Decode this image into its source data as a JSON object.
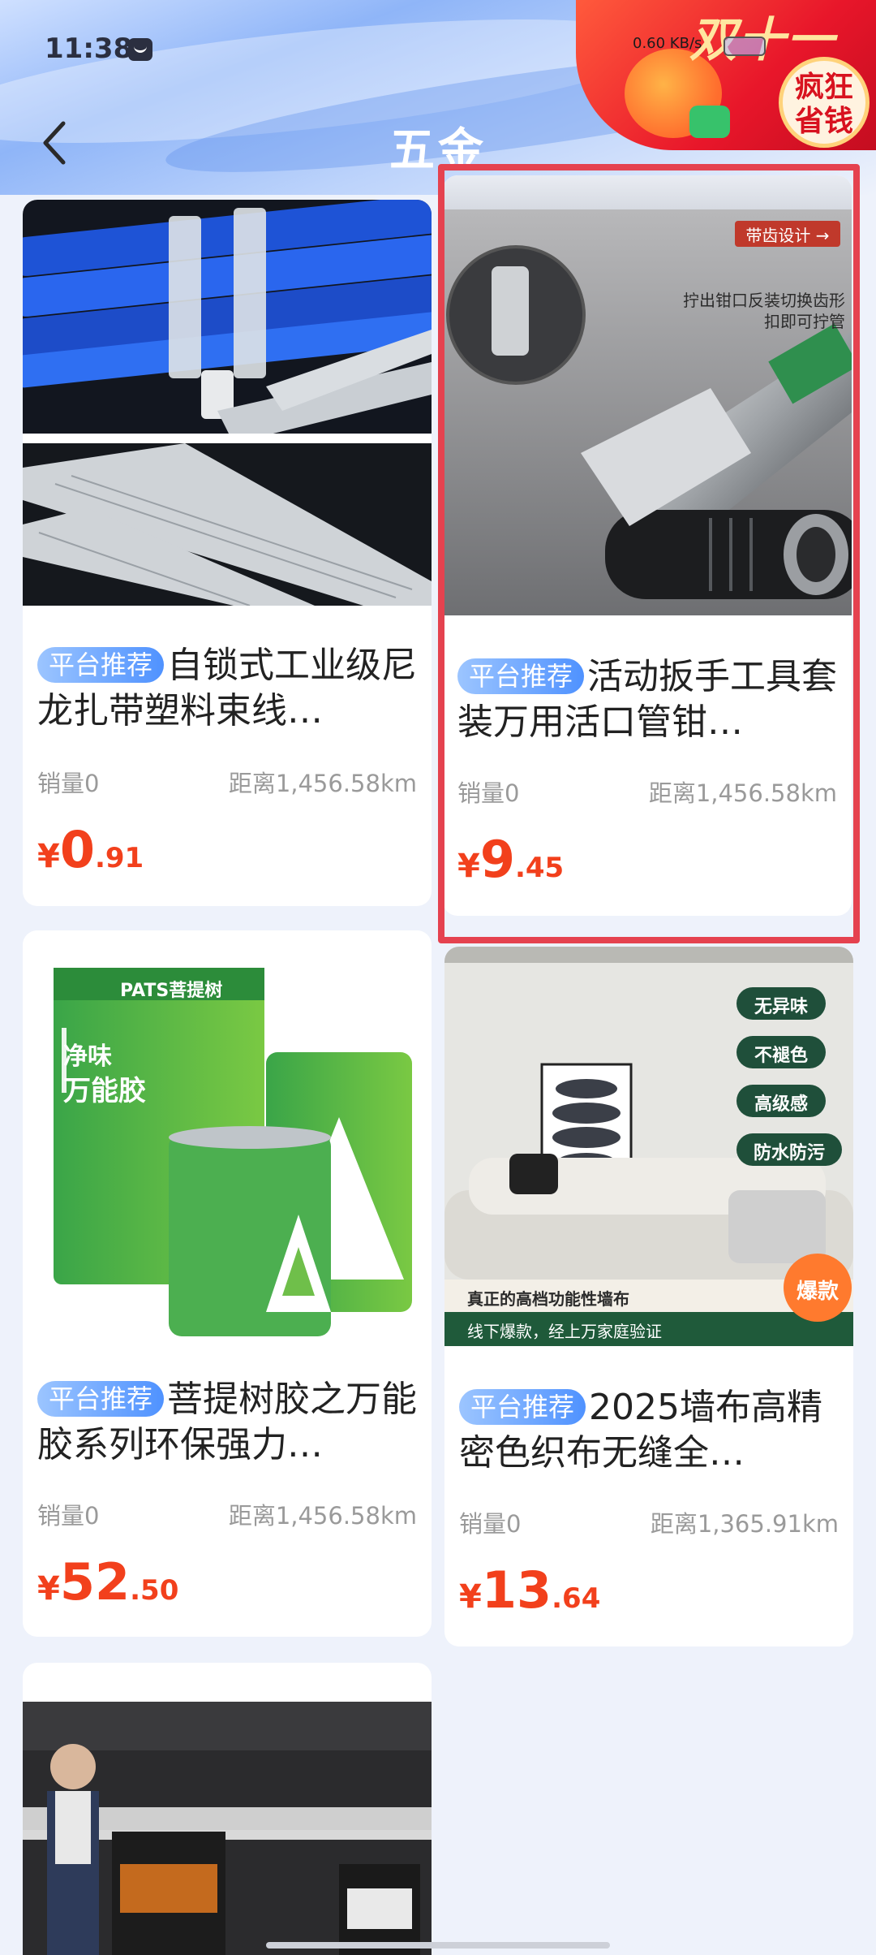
{
  "status_bar": {
    "time": "11:38",
    "network_speed": "0.60 KB/s"
  },
  "promo": {
    "title": "双十一",
    "badge": "疯狂省钱"
  },
  "header": {
    "title": "五金"
  },
  "products": [
    {
      "tag": "平台推荐",
      "title": "自锁式工业级尼龙扎带塑料束线…",
      "sales": "销量0",
      "distance": "距离1,456.58km",
      "price_symbol": "¥",
      "price_int": "0",
      "price_dec": ".91"
    },
    {
      "tag": "平台推荐",
      "title": "活动扳手工具套装万用活口管钳…",
      "sales": "销量0",
      "distance": "距离1,456.58km",
      "price_symbol": "¥",
      "price_int": "9",
      "price_dec": ".45",
      "image_text": {
        "label": "带齿设计 →",
        "desc_line1": "拧出钳口反装切换齿形",
        "desc_line2": "扣即可拧管"
      }
    },
    {
      "tag": "平台推荐",
      "title": "菩提树胶之万能胶系列环保强力…",
      "sales": "销量0",
      "distance": "距离1,456.58km",
      "price_symbol": "¥",
      "price_int": "52",
      "price_dec": ".50",
      "image_text": {
        "brand": "PATS菩提树",
        "product_line1": "净味",
        "product_line2": "万能胶"
      }
    },
    {
      "tag": "平台推荐",
      "title": "2025墙布高精密色织布无缝全…",
      "sales": "销量0",
      "distance": "距离1,365.91km",
      "price_symbol": "¥",
      "price_int": "13",
      "price_dec": ".64",
      "image_text": {
        "badges": [
          "无异味",
          "不褪色",
          "高级感",
          "防水防污"
        ],
        "caption1": "真正的高档功能性墙布",
        "caption2": "线下爆款，经上万家庭验证",
        "hot": "爆款"
      }
    }
  ],
  "colors": {
    "accent_price": "#f2401c",
    "highlight": "#e5424f",
    "tag_blue": "#4f92ff"
  }
}
